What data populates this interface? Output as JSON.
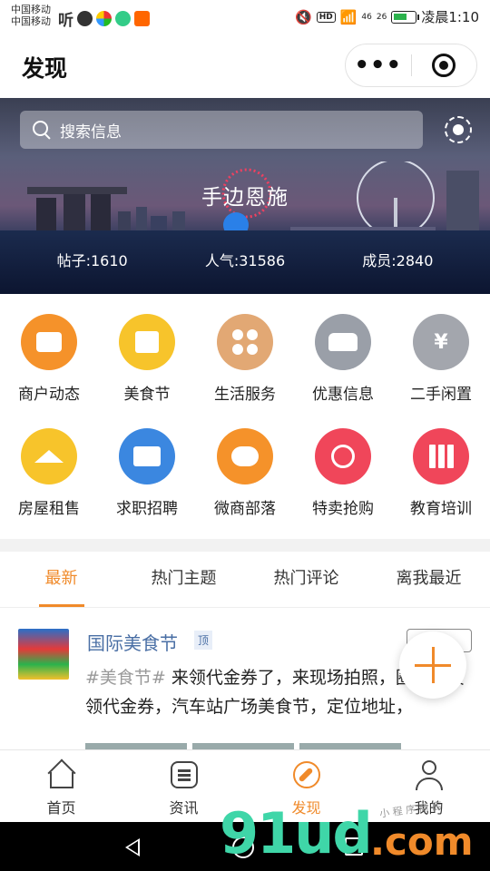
{
  "status_bar": {
    "carrier1": "中国移动",
    "carrier2": "中国移动",
    "listen": "听",
    "hd": "HD",
    "signal1": "46",
    "signal2": "26",
    "time": "凌晨1:10"
  },
  "header": {
    "title": "发现",
    "more_label": "•••"
  },
  "banner": {
    "search_placeholder": "搜索信息",
    "title": "手边恩施",
    "stats": [
      {
        "text": "帖子:1610"
      },
      {
        "text": "人气:31586"
      },
      {
        "text": "成员:2840"
      }
    ]
  },
  "grid": [
    {
      "label": "商户动态",
      "icon": "shop-icon",
      "color": "#f5922a"
    },
    {
      "label": "美食节",
      "icon": "shopping-bag-icon",
      "color": "#f7c42b"
    },
    {
      "label": "生活服务",
      "icon": "clover-icon",
      "color": "#e2a874"
    },
    {
      "label": "优惠信息",
      "icon": "car-icon",
      "color": "#9a9fa8"
    },
    {
      "label": "二手闲置",
      "icon": "yen-icon",
      "color": "#a3a6ad"
    },
    {
      "label": "房屋租售",
      "icon": "house-icon",
      "color": "#f7c42b"
    },
    {
      "label": "求职招聘",
      "icon": "briefcase-icon",
      "color": "#3b87e0"
    },
    {
      "label": "微商部落",
      "icon": "chat-icon",
      "color": "#f5922a"
    },
    {
      "label": "特卖抢购",
      "icon": "stopwatch-icon",
      "color": "#f0465a"
    },
    {
      "label": "教育培训",
      "icon": "books-icon",
      "color": "#f0465a"
    }
  ],
  "tabs": [
    {
      "label": "最新",
      "active": true
    },
    {
      "label": "热门主题",
      "active": false
    },
    {
      "label": "热门评论",
      "active": false
    },
    {
      "label": "离我最近",
      "active": false
    }
  ],
  "post": {
    "title": "国际美食节",
    "badge": "顶",
    "tag": "#美食节#",
    "body": " 来领代金券了，来现场拍照，圈，免费领代金券，汽车站广场美食节，定位地址，"
  },
  "bottom_nav": [
    {
      "label": "首页",
      "icon": "home-icon",
      "active": false
    },
    {
      "label": "资讯",
      "icon": "news-icon",
      "active": false
    },
    {
      "label": "发现",
      "icon": "compass-icon",
      "active": true
    },
    {
      "label": "我的",
      "icon": "profile-icon",
      "active": false
    }
  ],
  "watermark": {
    "logo": "91ud",
    "suffix": ".com",
    "small": "小 程 序 商 店"
  },
  "colors": {
    "accent": "#f08a2a",
    "link": "#4a6fa5"
  }
}
